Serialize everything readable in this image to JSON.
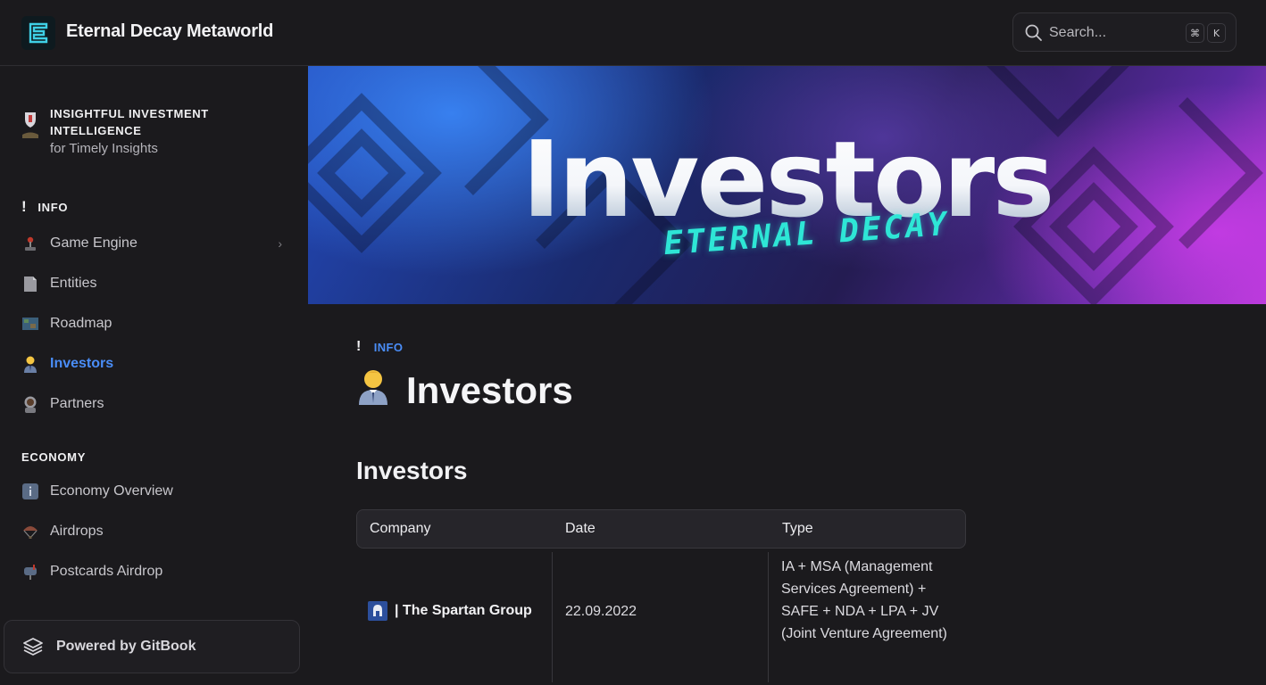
{
  "header": {
    "title": "Eternal Decay Metaworld",
    "search_placeholder": "Search...",
    "shortcut_keys": [
      "⌘",
      "K"
    ]
  },
  "sidebar": {
    "promo": {
      "title": "INSIGHTFUL INVESTMENT INTELLIGENCE",
      "subtitle": "for Timely Insights"
    },
    "sections": [
      {
        "label": "INFO",
        "items": [
          {
            "label": "Game Engine",
            "icon": "joystick-icon",
            "has_children": true
          },
          {
            "label": "Entities",
            "icon": "page-icon"
          },
          {
            "label": "Roadmap",
            "icon": "map-icon"
          },
          {
            "label": "Investors",
            "icon": "office-worker-icon",
            "active": true
          },
          {
            "label": "Partners",
            "icon": "astronaut-icon"
          }
        ]
      },
      {
        "label": "ECONOMY",
        "items": [
          {
            "label": "Economy Overview",
            "icon": "info-icon"
          },
          {
            "label": "Airdrops",
            "icon": "parachute-icon"
          },
          {
            "label": "Postcards Airdrop",
            "icon": "mailbox-icon"
          }
        ]
      }
    ],
    "powered_by": "Powered by GitBook"
  },
  "banner": {
    "title": "Investors",
    "subtitle": "ETERNAL DECAY"
  },
  "page": {
    "breadcrumb": "INFO",
    "title": "Investors",
    "title_icon": "office-worker-icon",
    "section_heading": "Investors",
    "table": {
      "columns": [
        "Company",
        "Date",
        "Type"
      ],
      "rows": [
        {
          "company": "| The Spartan Group",
          "date": "22.09.2022",
          "type": "IA + MSA (Management Services Agreement) + SAFE + NDA + LPA + JV (Joint Venture Agreement)"
        }
      ]
    }
  },
  "colors": {
    "background": "#1b1a1d",
    "accent": "#4a8df7",
    "banner_subtitle": "#2ee6d6"
  }
}
